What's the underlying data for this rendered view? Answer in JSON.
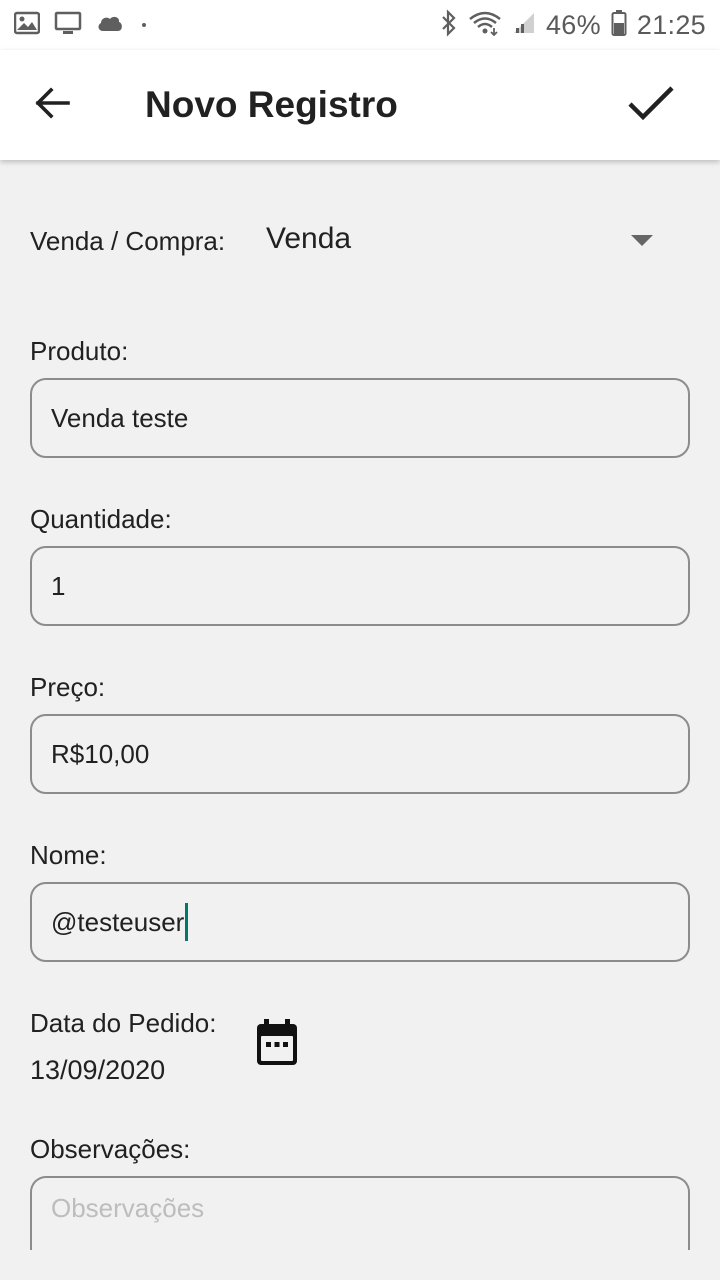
{
  "status_bar": {
    "battery": "46%",
    "time": "21:25",
    "icons_left": [
      "image-icon",
      "monitor-icon",
      "cloud-icon"
    ],
    "icons_right": [
      "bluetooth-icon",
      "wifi-icon",
      "signal-icon",
      "battery-icon"
    ]
  },
  "app_bar": {
    "title": "Novo Registro",
    "back_icon": "arrow-back-icon",
    "confirm_icon": "check-icon"
  },
  "form": {
    "type": {
      "label": "Venda / Compra:",
      "value": "Venda"
    },
    "produto": {
      "label": "Produto:",
      "value": "Venda teste"
    },
    "quantidade": {
      "label": "Quantidade:",
      "value": "1"
    },
    "preco": {
      "label": "Preço:",
      "value": "R$10,00"
    },
    "nome": {
      "label": "Nome:",
      "value": "@testeuser"
    },
    "data": {
      "label": "Data do Pedido:",
      "value": "13/09/2020",
      "icon": "calendar-icon"
    },
    "observacoes": {
      "label": "Observações:",
      "placeholder": "Observações"
    }
  },
  "colors": {
    "accent": "#00796b",
    "background": "#f1f1f1",
    "appbar": "#ffffff",
    "border": "#8c8c8c"
  }
}
